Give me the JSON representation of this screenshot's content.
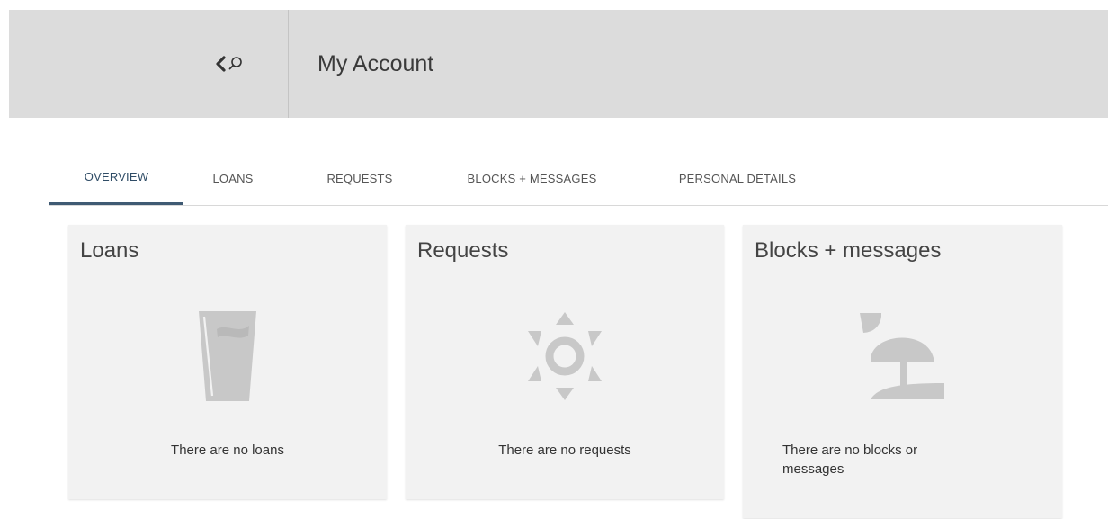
{
  "header": {
    "title": "My Account",
    "back_icon": "back-search-icon"
  },
  "tabs": [
    {
      "label": "OVERVIEW",
      "active": true
    },
    {
      "label": "LOANS",
      "active": false
    },
    {
      "label": "REQUESTS",
      "active": false
    },
    {
      "label": "BLOCKS + MESSAGES",
      "active": false
    },
    {
      "label": "PERSONAL DETAILS",
      "active": false
    }
  ],
  "cards": {
    "loans": {
      "title": "Loans",
      "icon": "glass-icon",
      "message": "There are no loans"
    },
    "requests": {
      "title": "Requests",
      "icon": "sun-icon",
      "message": "There are no requests"
    },
    "blocks": {
      "title": "Blocks + messages",
      "icon": "beach-umbrella-icon",
      "message": "There are no blocks or messages"
    }
  },
  "colors": {
    "header_bg": "#dcdcdc",
    "card_bg": "#f2f2f2",
    "icon_gray": "#c8c8c8",
    "active_tab": "#3f5a73"
  }
}
